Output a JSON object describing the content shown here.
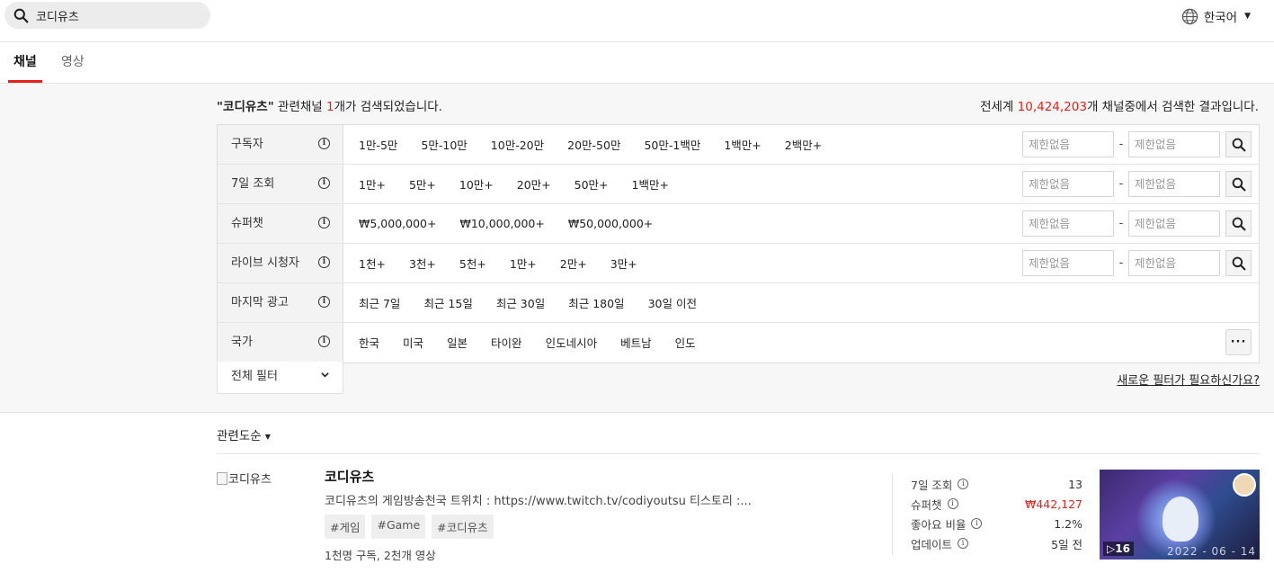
{
  "search": {
    "value": "코디유츠"
  },
  "language": {
    "label": "한국어"
  },
  "tabs": [
    {
      "label": "채널",
      "active": true
    },
    {
      "label": "영상",
      "active": false
    }
  ],
  "summary": {
    "prefix": "\"코디유츠\"",
    "mid": " 관련채널 ",
    "count": "1",
    "suffix": "개가 검색되었습니다.",
    "right_prefix": "전세계 ",
    "total": "10,424,203",
    "right_suffix": "개 채널중에서 검색한 결과입니다."
  },
  "filters": {
    "rows": [
      {
        "label": "구독자",
        "options": [
          "1만-5만",
          "5만-10만",
          "10만-20만",
          "20만-50만",
          "50만-1백만",
          "1백만+",
          "2백만+"
        ],
        "range": true
      },
      {
        "label": "7일 조회",
        "options": [
          "1만+",
          "5만+",
          "10만+",
          "20만+",
          "50만+",
          "1백만+"
        ],
        "range": true
      },
      {
        "label": "슈퍼챗",
        "options": [
          "₩5,000,000+",
          "₩10,000,000+",
          "₩50,000,000+"
        ],
        "range": true
      },
      {
        "label": "라이브 시청자",
        "options": [
          "1천+",
          "3천+",
          "5천+",
          "1만+",
          "2만+",
          "3만+"
        ],
        "range": true
      },
      {
        "label": "마지막 광고",
        "options": [
          "최근 7일",
          "최근 15일",
          "최근 30일",
          "최근 180일",
          "30일 이전"
        ],
        "range": false
      },
      {
        "label": "국가",
        "options": [
          "한국",
          "미국",
          "일본",
          "타이완",
          "인도네시아",
          "베트남",
          "인도"
        ],
        "range": false,
        "more": true
      }
    ],
    "range_placeholder": "제한없음",
    "range_dash": "-",
    "all_filter_label": "전체 필터",
    "new_filter_link": "새로운 필터가 필요하신가요?"
  },
  "sort": {
    "label": "관련도순"
  },
  "result": {
    "thumb_alt": "코디유츠",
    "name": "코디유츠",
    "description": "코디유츠의 게임방송천국 트위치 : https://www.twitch.tv/codiyoutsu 티스토리 :...",
    "tags": [
      "#게임",
      "#Game",
      "#코디유츠"
    ],
    "meta": "1천명 구독, 2천개 영상",
    "stats": [
      {
        "label": "7일 조회",
        "value": "13",
        "highlight": false
      },
      {
        "label": "슈퍼챗",
        "value": "₩442,127",
        "highlight": true
      },
      {
        "label": "좋아요 비율",
        "value": "1.2%",
        "highlight": false
      },
      {
        "label": "업데이트",
        "value": "5일 전",
        "highlight": false
      }
    ],
    "video": {
      "count": "16",
      "date": "2022 - 06 - 14"
    }
  },
  "colors": {
    "accent": "#e2231a"
  }
}
